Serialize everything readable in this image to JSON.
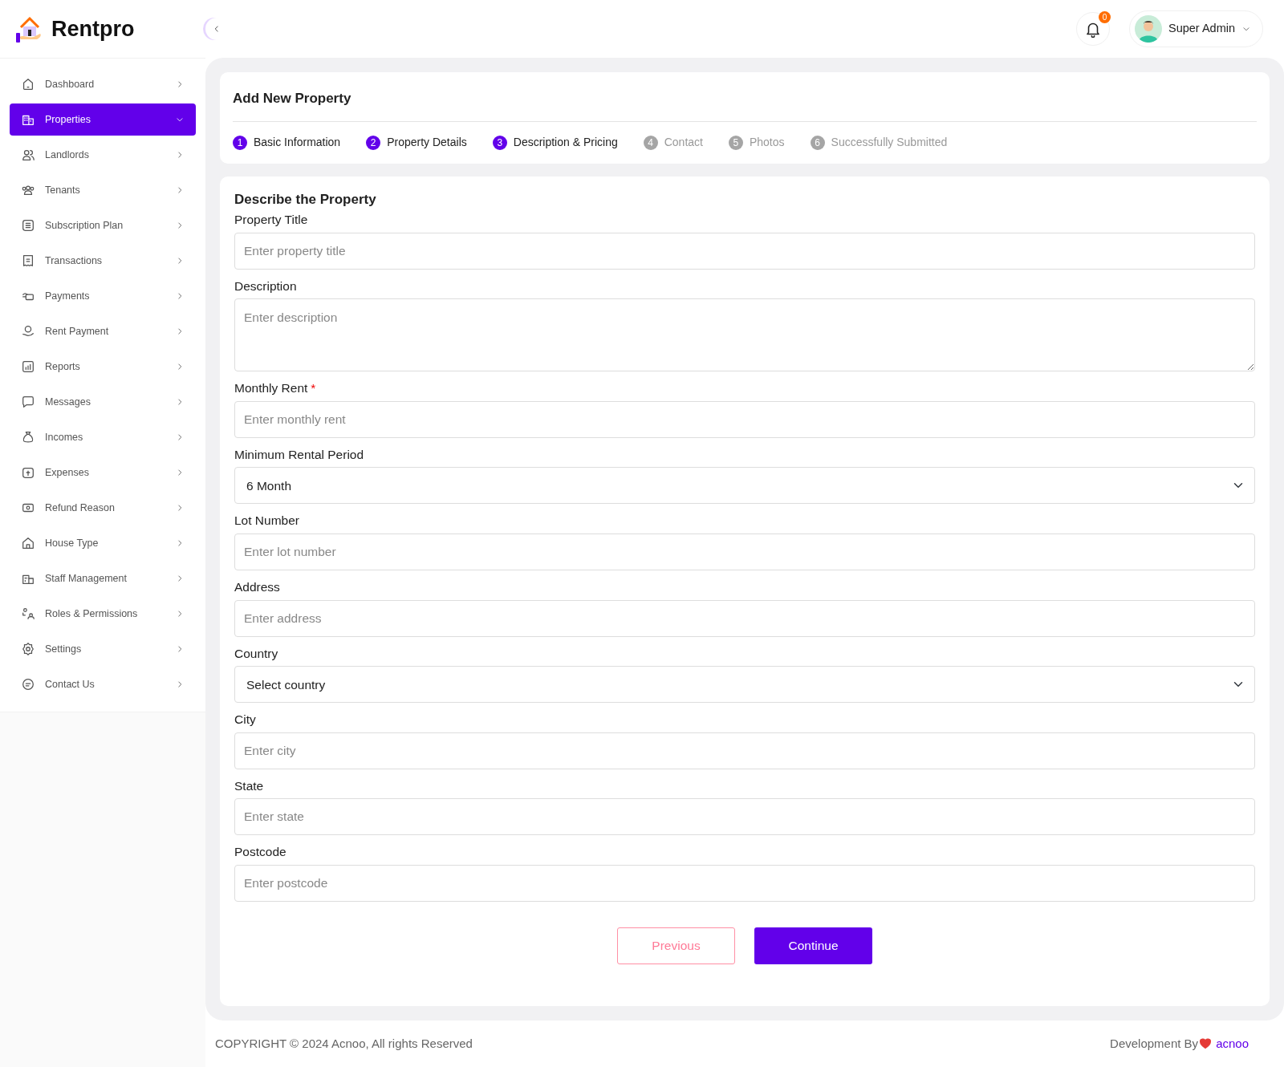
{
  "brand": {
    "name": "Rentpro"
  },
  "sidebar": {
    "items": [
      {
        "label": "Dashboard",
        "selected": false
      },
      {
        "label": "Properties",
        "selected": true
      },
      {
        "label": "Landlords",
        "selected": false
      },
      {
        "label": "Tenants",
        "selected": false
      },
      {
        "label": "Subscription Plan",
        "selected": false
      },
      {
        "label": "Transactions",
        "selected": false
      },
      {
        "label": "Payments",
        "selected": false
      },
      {
        "label": "Rent Payment",
        "selected": false
      },
      {
        "label": "Reports",
        "selected": false
      },
      {
        "label": "Messages",
        "selected": false
      },
      {
        "label": "Incomes",
        "selected": false
      },
      {
        "label": "Expenses",
        "selected": false
      },
      {
        "label": "Refund Reason",
        "selected": false
      },
      {
        "label": "House Type",
        "selected": false
      },
      {
        "label": "Staff Management",
        "selected": false
      },
      {
        "label": "Roles & Permissions",
        "selected": false
      },
      {
        "label": "Settings",
        "selected": false
      },
      {
        "label": "Contact Us",
        "selected": false
      }
    ]
  },
  "header": {
    "notification_count": "0",
    "user": "Super Admin"
  },
  "wizard": {
    "title": "Add New Property",
    "steps": [
      {
        "number": "1",
        "label": "Basic Information",
        "done": true
      },
      {
        "number": "2",
        "label": "Property Details",
        "done": true
      },
      {
        "number": "3",
        "label": "Description & Pricing",
        "done": true
      },
      {
        "number": "4",
        "label": "Contact",
        "done": false
      },
      {
        "number": "5",
        "label": "Photos",
        "done": false
      },
      {
        "number": "6",
        "label": "Successfully Submitted",
        "done": false
      }
    ]
  },
  "form": {
    "title": "Describe the Property",
    "fields": [
      {
        "kind": "input",
        "label": "Property Title",
        "placeholder": "Enter property title"
      },
      {
        "kind": "textarea",
        "label": "Description",
        "placeholder": "Enter description"
      },
      {
        "kind": "input",
        "label": "Monthly Rent",
        "required_mark": "*",
        "placeholder": "Enter monthly rent"
      },
      {
        "kind": "select",
        "label": "Minimum Rental Period",
        "value": "6 Month"
      },
      {
        "kind": "input",
        "label": "Lot Number",
        "placeholder": "Enter lot number"
      },
      {
        "kind": "input",
        "label": "Address",
        "placeholder": "Enter address"
      },
      {
        "kind": "select",
        "label": "Country",
        "value": "Select country"
      },
      {
        "kind": "input",
        "label": "City",
        "placeholder": "Enter city"
      },
      {
        "kind": "input",
        "label": "State",
        "placeholder": "Enter state"
      },
      {
        "kind": "input",
        "label": "Postcode",
        "placeholder": "Enter postcode"
      }
    ],
    "buttons": {
      "previous": "Previous",
      "continue": "Continue"
    }
  },
  "footer": {
    "copyright": "COPYRIGHT © 2024 Acnoo, All rights Reserved",
    "credit": "Development By",
    "credit_link": "acnoo"
  }
}
